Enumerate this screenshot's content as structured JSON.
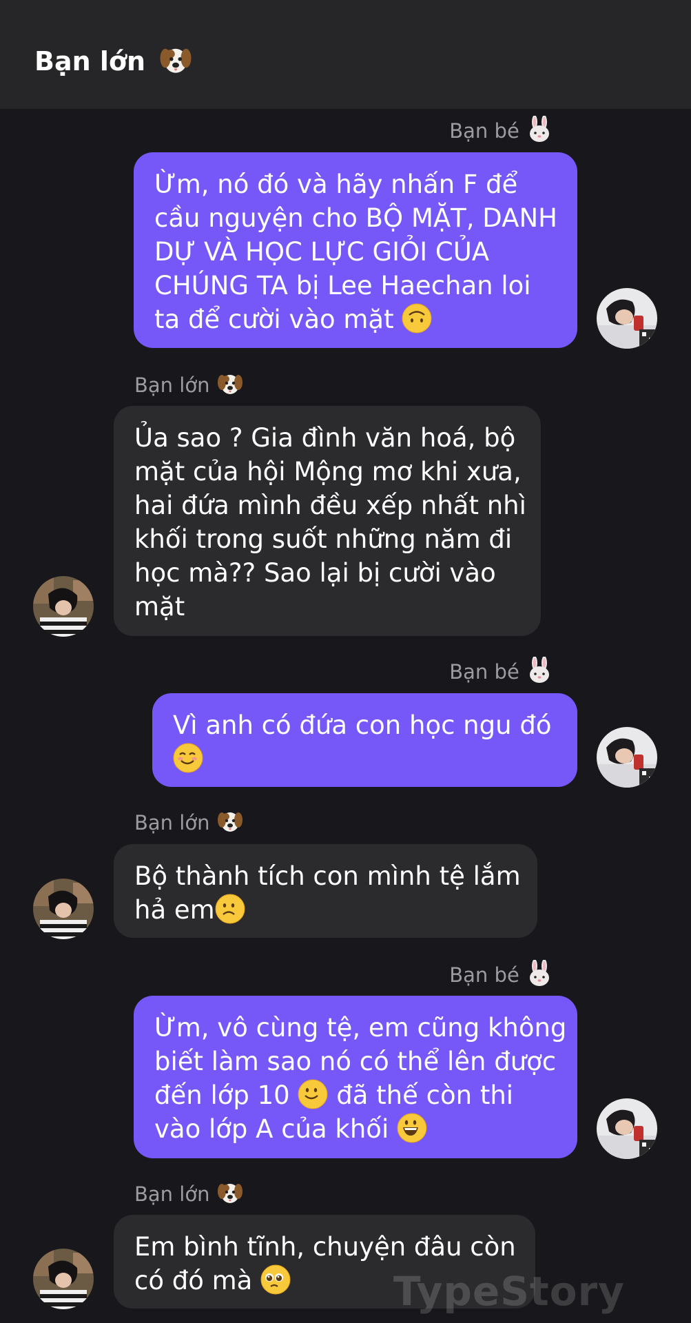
{
  "header": {
    "title": "Bạn lớn",
    "title_icon": "dog-face-icon"
  },
  "participants": {
    "me": {
      "name": "Bạn bé",
      "icon": "rabbit-face-icon"
    },
    "them": {
      "name": "Bạn lớn",
      "icon": "dog-face-icon"
    }
  },
  "messages": [
    {
      "side": "me",
      "sender": "Bạn bé",
      "lines": [
        "Ừm, nó đó và hãy nhấn F để",
        "cầu nguyện cho BỘ MẶT, DANH",
        "DỰ VÀ HỌC LỰC GIỎI CỦA",
        "CHÚNG TA bị Lee Haechan loi",
        "ta để cười vào mặt"
      ],
      "trailing_emoji": "upside-down-face-icon"
    },
    {
      "side": "them",
      "sender": "Bạn lớn",
      "lines": [
        "Ủa sao ? Gia đình văn hoá, bộ",
        "mặt của hội Mộng mơ khi xưa,",
        "hai đứa mình đều xếp nhất nhì",
        "khối trong suốt những năm đi",
        "học mà?? Sao lại bị cười vào",
        "mặt"
      ]
    },
    {
      "side": "me",
      "sender": "Bạn bé",
      "lines": [
        "Vì anh có đứa con học ngu đó",
        ""
      ],
      "trailing_emoji": "smiling-face-icon"
    },
    {
      "side": "them",
      "sender": "Bạn lớn",
      "lines": [
        "Bộ thành tích con mình tệ lắm",
        "hả em"
      ],
      "trailing_emoji": "frowning-face-icon"
    },
    {
      "side": "me",
      "sender": "Bạn bé",
      "lines": [
        "Ừm, vô cùng tệ, em cũng không",
        "biết làm sao nó có thể lên được",
        "đến lớp 10",
        "đã thế còn thi",
        "vào lớp A của khối"
      ]
    },
    {
      "side": "them",
      "sender": "Bạn lớn",
      "lines": [
        "Em bình tĩnh, chuyện đâu còn",
        "có đó mà"
      ],
      "trailing_emoji": "pleading-face-icon"
    }
  ],
  "watermark": "TypeStory",
  "colors": {
    "background": "#18181c",
    "header": "#262628",
    "me_bubble": "#7657f7",
    "them_bubble": "#2b2b2e",
    "sender_text": "#9b9ba2"
  }
}
